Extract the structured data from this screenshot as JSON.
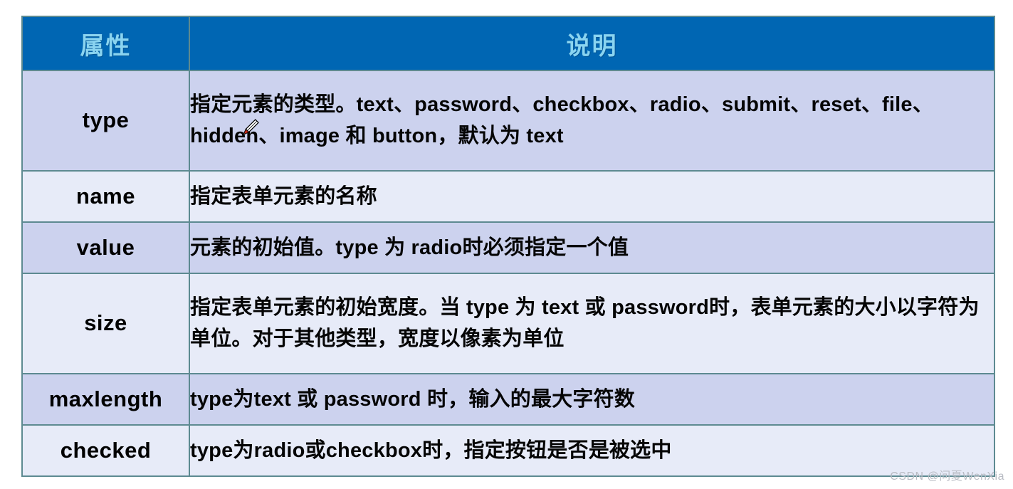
{
  "table": {
    "headers": [
      "属性",
      "说明"
    ],
    "rows": [
      {
        "attribute": "type",
        "description": "指定元素的类型。text、password、checkbox、radio、submit、reset、file、hidden、image 和 button，默认为 text",
        "shade": "dark"
      },
      {
        "attribute": "name",
        "description": "指定表单元素的名称",
        "shade": "light"
      },
      {
        "attribute": "value",
        "description": "元素的初始值。type 为 radio时必须指定一个值",
        "shade": "dark"
      },
      {
        "attribute": "size",
        "description": "指定表单元素的初始宽度。当 type 为 text 或 password时，表单元素的大小以字符为单位。对于其他类型，宽度以像素为单位",
        "shade": "light"
      },
      {
        "attribute": "maxlength",
        "description": "type为text 或 password 时，输入的最大字符数",
        "shade": "dark"
      },
      {
        "attribute": "checked",
        "description": "type为radio或checkbox时，指定按钮是否是被选中",
        "shade": "light"
      }
    ]
  },
  "cursor": {
    "name": "pencil-annotation-cursor"
  },
  "watermark": {
    "text": "CSDN @问夏WenXia"
  },
  "colors": {
    "header_background": "#0066b3",
    "header_text": "#8ad4f0",
    "row_dark": "#ccd2ee",
    "row_light": "#e7ebf8",
    "border": "#5d8a91",
    "body_text": "#050505",
    "watermark_text": "#b9bcc4"
  }
}
